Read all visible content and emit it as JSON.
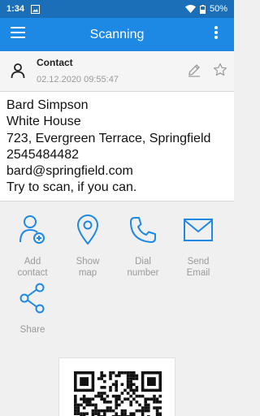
{
  "status_bar": {
    "time": "1:34",
    "battery": "50%"
  },
  "app_bar": {
    "title": "Scanning"
  },
  "header": {
    "type_label": "Contact",
    "date": "02.12.2020 09:55:47"
  },
  "contact_lines": [
    "Bard Simpson",
    "White House",
    "723, Evergreen Terrace, Springfield",
    "2545484482",
    "bard@springfield.com",
    "Try to scan, if you can."
  ],
  "actions": {
    "add_contact": {
      "line1": "Add",
      "line2": "contact"
    },
    "show_map": {
      "line1": "Show",
      "line2": "map"
    },
    "dial_number": {
      "line1": "Dial",
      "line2": "number"
    },
    "send_email": {
      "line1": "Send",
      "line2": "Email"
    },
    "share": {
      "line1": "Share"
    }
  },
  "colors": {
    "accent": "#1e88e5",
    "status_bar": "#1a6fb8",
    "icon_blue": "#1e88e5",
    "label_gray": "#9a9a9a"
  }
}
